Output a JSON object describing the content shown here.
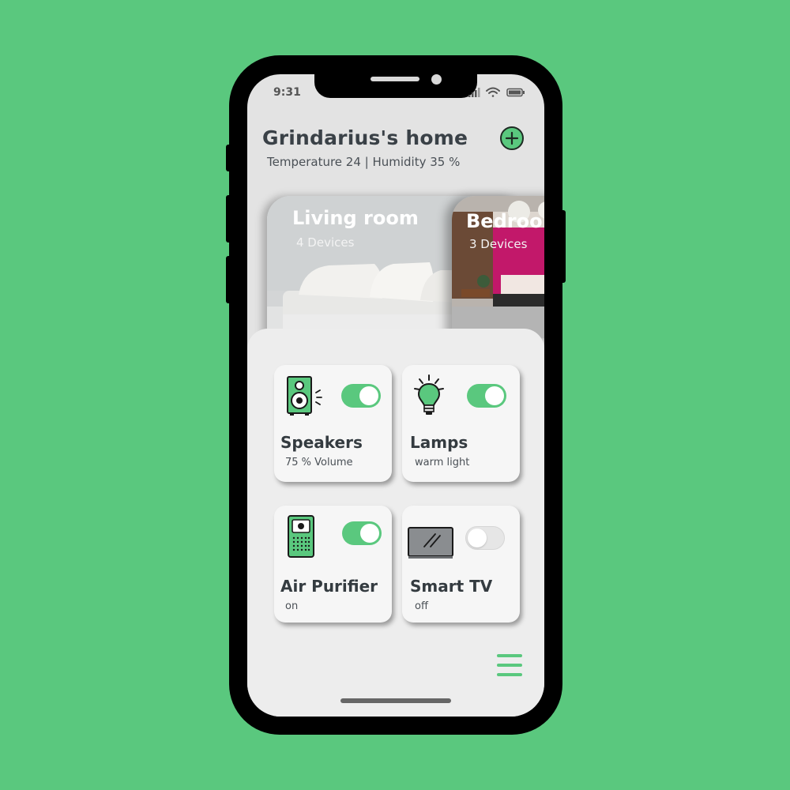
{
  "status_bar": {
    "time": "9:31"
  },
  "header": {
    "title": "Grindarius's home",
    "subtitle": "Temperature 24 | Humidity 35 %"
  },
  "rooms": [
    {
      "name": "Living room",
      "devices": "4 Devices"
    },
    {
      "name": "Bedroom",
      "devices": "3 Devices"
    }
  ],
  "devices": [
    {
      "name": "Speakers",
      "status": "75 % Volume",
      "icon": "speaker-icon",
      "on": true
    },
    {
      "name": "Lamps",
      "status": "warm light",
      "icon": "lightbulb-icon",
      "on": true
    },
    {
      "name": "Air Purifier",
      "status": "on",
      "icon": "air-purifier-icon",
      "on": true
    },
    {
      "name": "Smart TV",
      "status": "off",
      "icon": "tv-icon",
      "on": false
    }
  ],
  "colors": {
    "background": "#5ac87e",
    "accent": "#5ac87e",
    "text_dark": "#3a4147"
  }
}
